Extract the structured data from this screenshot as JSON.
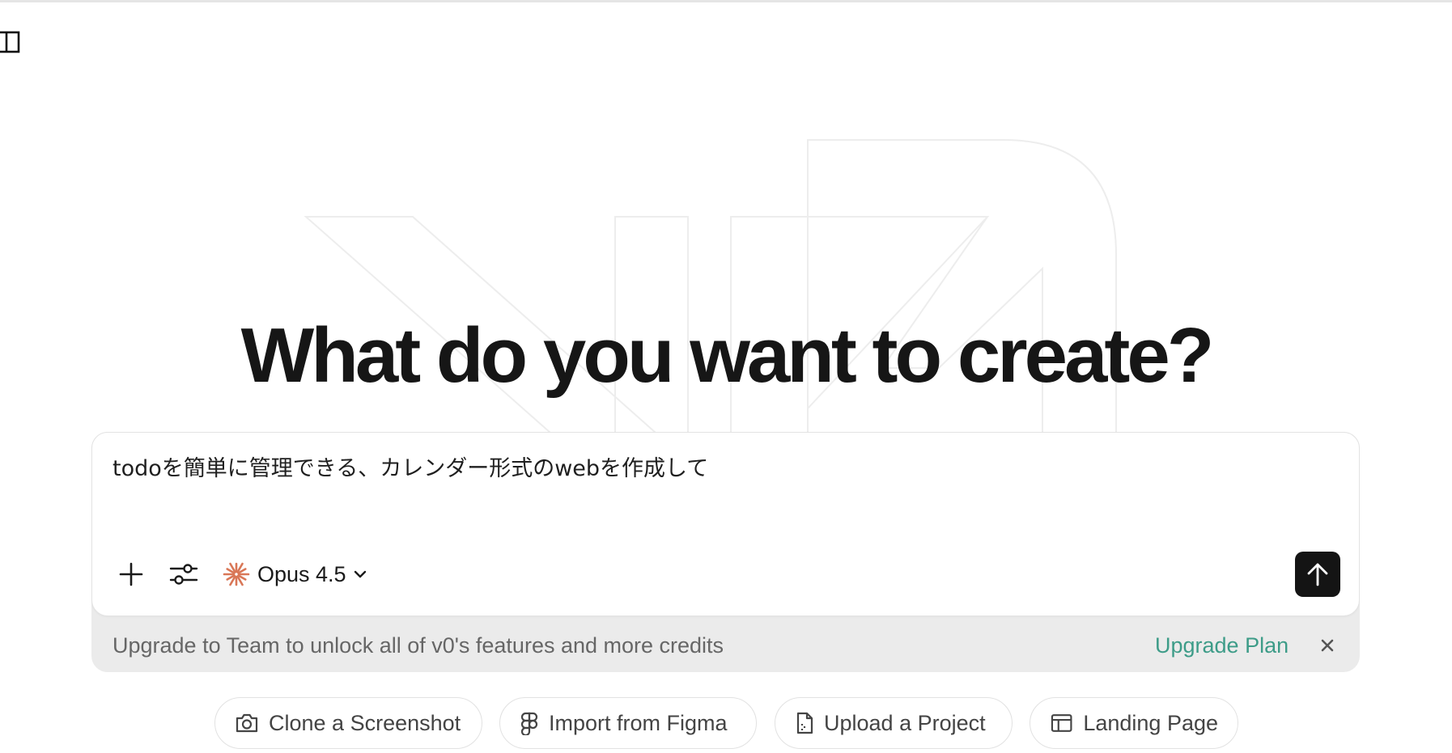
{
  "headline": "What do you want to create?",
  "composer": {
    "prompt_value": "todoを簡単に管理できる、カレンダー形式のwebを作成して",
    "model": {
      "label": "Opus 4.5",
      "icon": "claude-sunburst-icon",
      "icon_color": "#d97757"
    },
    "tools": [
      {
        "name": "add-attachment",
        "icon": "plus-icon"
      },
      {
        "name": "settings",
        "icon": "sliders-icon"
      }
    ],
    "send_icon": "arrow-up-icon"
  },
  "upgrade_banner": {
    "text": "Upgrade to Team to unlock all of v0's features and more credits",
    "link": "Upgrade Plan",
    "link_color": "#3d9c88",
    "dismiss_icon": "close-icon"
  },
  "suggestions": [
    {
      "label": "Clone a Screenshot",
      "icon": "camera-icon"
    },
    {
      "label": "Import from Figma",
      "icon": "figma-icon"
    },
    {
      "label": "Upload a Project",
      "icon": "file-upload-icon"
    },
    {
      "label": "Landing Page",
      "icon": "layout-icon"
    }
  ],
  "colors": {
    "text_primary": "#161616",
    "send_button": "#141414",
    "banner_bg": "#ebebeb"
  }
}
